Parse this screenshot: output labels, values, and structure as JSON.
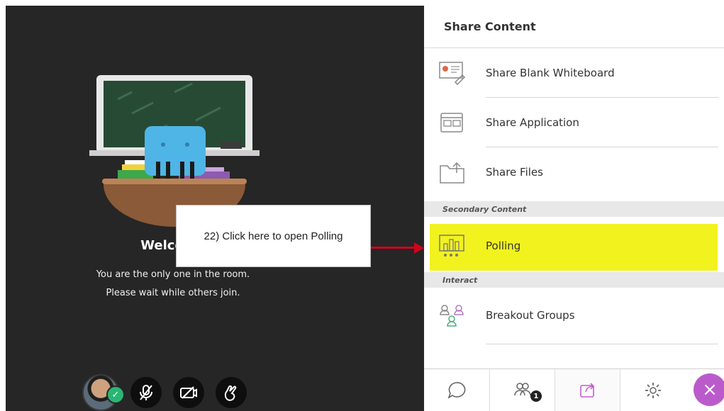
{
  "stage": {
    "welcome_title": "Welcome",
    "line1": "You are the only one in the room.",
    "line2": "Please wait while others join.",
    "online_check": "✓"
  },
  "callout": {
    "text": "22) Click here to open Polling"
  },
  "panel": {
    "title": "Share Content",
    "items": [
      {
        "label": "Share Blank Whiteboard",
        "icon": "whiteboard-icon"
      },
      {
        "label": "Share Application",
        "icon": "application-icon"
      },
      {
        "label": "Share Files",
        "icon": "files-icon"
      }
    ],
    "secondary_header": "Secondary Content",
    "polling": {
      "label": "Polling",
      "icon": "polling-icon"
    },
    "interact_header": "Interact",
    "breakout": {
      "label": "Breakout Groups",
      "icon": "breakout-icon"
    }
  },
  "tabs": {
    "attendees_count": "1",
    "close_symbol": "×"
  },
  "colors": {
    "stage_bg": "#262626",
    "highlight": "#f2f21f",
    "arrow": "#d0021b",
    "accent_purple": "#bb5bcb"
  }
}
